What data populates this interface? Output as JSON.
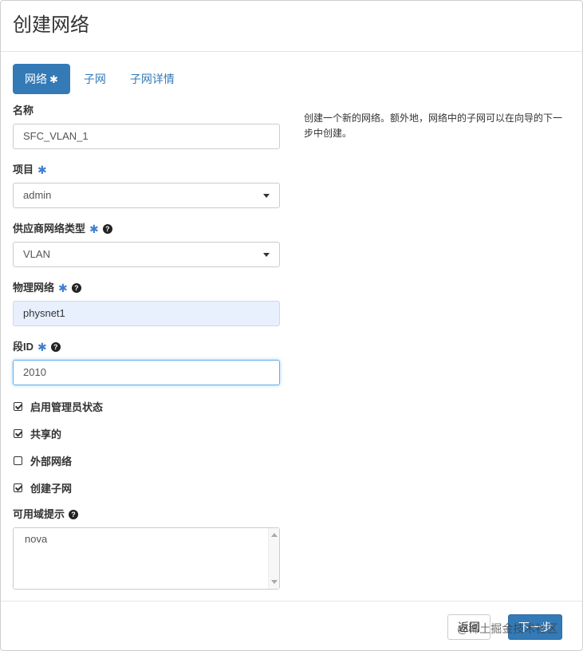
{
  "header": {
    "title": "创建网络"
  },
  "tabs": [
    {
      "label": "网络",
      "star": "✱"
    },
    {
      "label": "子网"
    },
    {
      "label": "子网详情"
    }
  ],
  "form": {
    "name": {
      "label": "名称",
      "value": "SFC_VLAN_1"
    },
    "project": {
      "label": "项目",
      "value": "admin"
    },
    "provider_type": {
      "label": "供应商网络类型",
      "value": "VLAN"
    },
    "physical_network": {
      "label": "物理网络",
      "value": "physnet1"
    },
    "segment_id": {
      "label": "段ID",
      "value": "2010"
    },
    "checkboxes": [
      {
        "label": "启用管理员状态",
        "checked": true
      },
      {
        "label": "共享的",
        "checked": true
      },
      {
        "label": "外部网络",
        "checked": false
      },
      {
        "label": "创建子网",
        "checked": true
      }
    ],
    "az_hint": {
      "label": "可用域提示",
      "value": "nova"
    }
  },
  "description": "创建一个新的网络。额外地，网络中的子网可以在向导的下一步中创建。",
  "footer": {
    "back_label": "返回",
    "next_label": "下一步",
    "watermark": "@稀土掘金技术社区"
  },
  "icons": {
    "required": "✱",
    "help": "?"
  },
  "colors": {
    "primary": "#337ab7",
    "required_star": "#3f7fcf"
  }
}
